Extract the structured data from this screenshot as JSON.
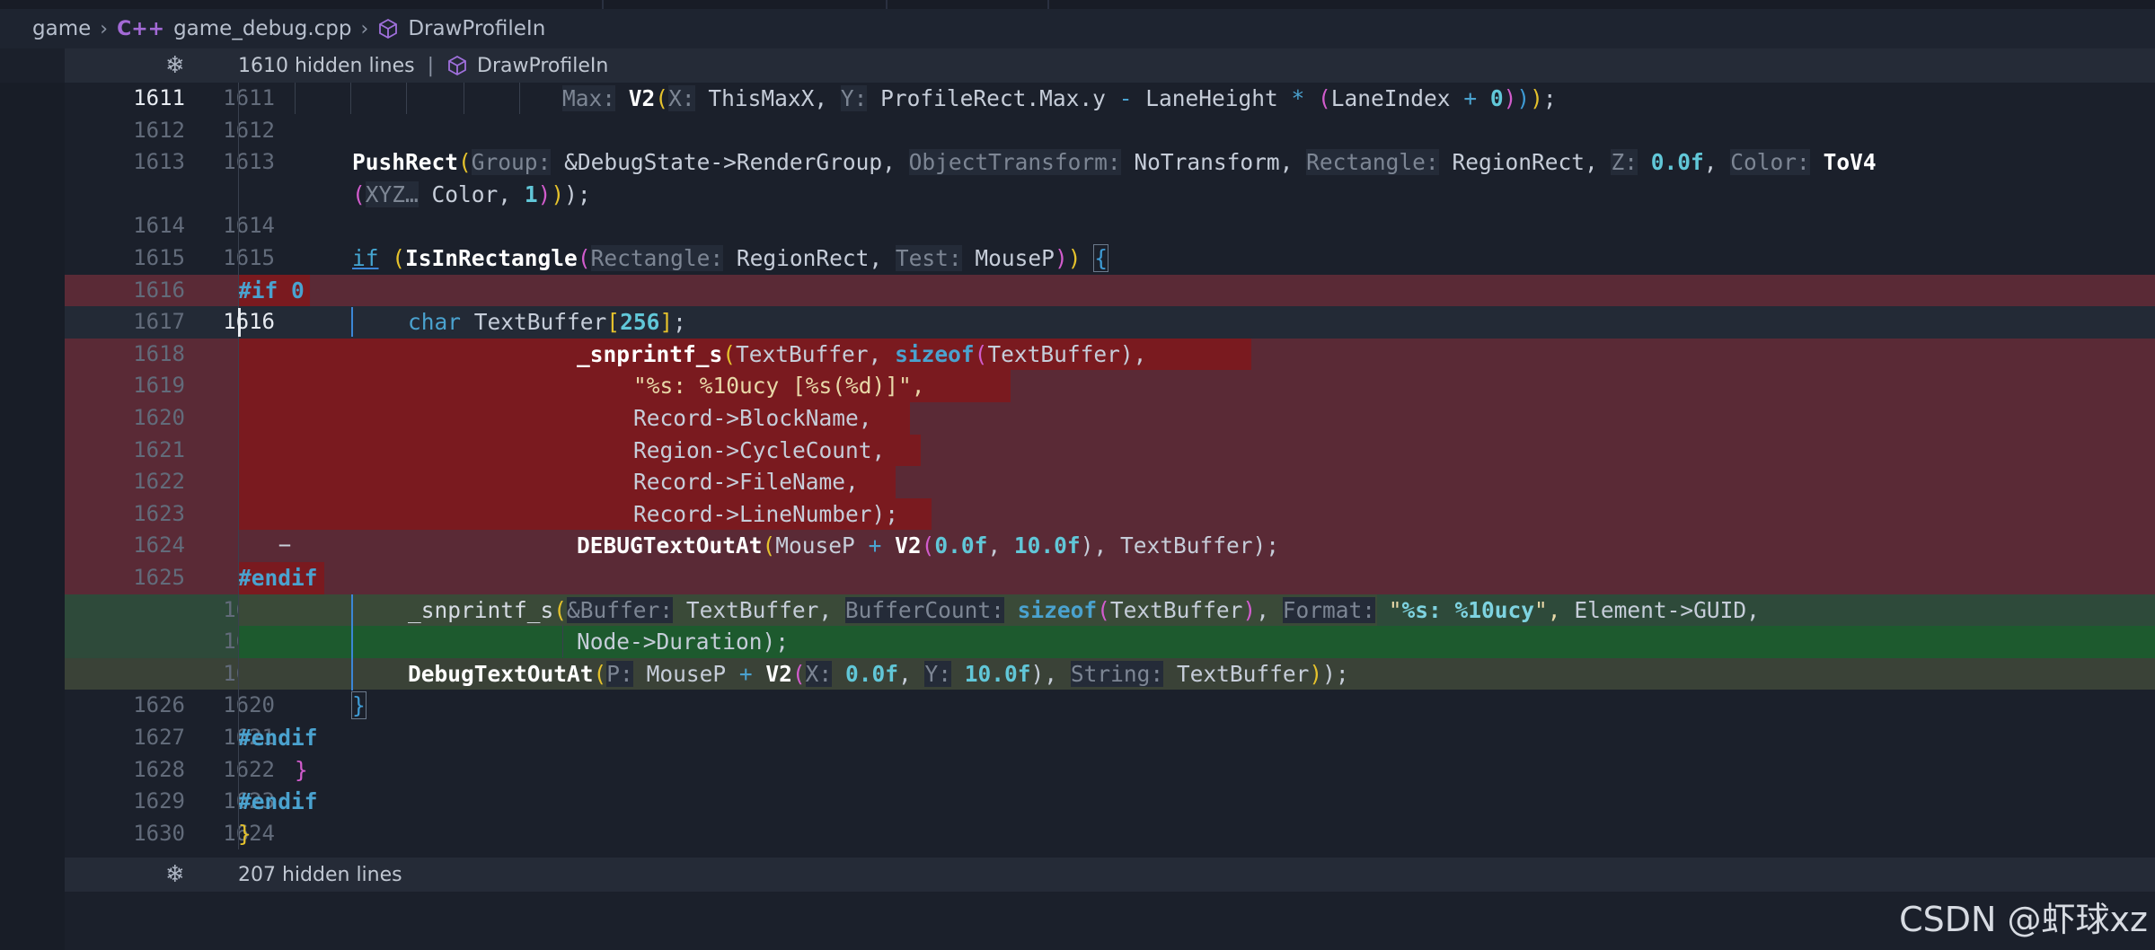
{
  "breadcrumb": {
    "folder": "game",
    "file_icon": "C++",
    "file": "game_debug.cpp",
    "symbol": "DrawProfileIn"
  },
  "top_fold": {
    "hidden": "1610 hidden lines",
    "context": "DrawProfileIn"
  },
  "bottom_fold": {
    "hidden": "207 hidden lines"
  },
  "lines": [
    {
      "old": "1611",
      "new": "1611",
      "mark": ""
    },
    {
      "old": "1612",
      "new": "1612",
      "mark": ""
    },
    {
      "old": "1613",
      "new": "1613",
      "mark": ""
    },
    {
      "old": "",
      "new": "",
      "mark": ""
    },
    {
      "old": "1614",
      "new": "1614",
      "mark": ""
    },
    {
      "old": "1615",
      "new": "1615",
      "mark": ""
    },
    {
      "old": "1616",
      "new": "",
      "mark": "−"
    },
    {
      "old": "1617",
      "new": "1616",
      "mark": ""
    },
    {
      "old": "1618",
      "new": "",
      "mark": "−"
    },
    {
      "old": "1619",
      "new": "",
      "mark": "−"
    },
    {
      "old": "1620",
      "new": "",
      "mark": "−"
    },
    {
      "old": "1621",
      "new": "",
      "mark": "−"
    },
    {
      "old": "1622",
      "new": "",
      "mark": "−"
    },
    {
      "old": "1623",
      "new": "",
      "mark": "−"
    },
    {
      "old": "1624",
      "new": "",
      "mark": "−"
    },
    {
      "old": "1625",
      "new": "",
      "mark": "−"
    },
    {
      "old": "",
      "new": "1617",
      "mark": "+"
    },
    {
      "old": "",
      "new": "1618",
      "mark": "+"
    },
    {
      "old": "",
      "new": "1619",
      "mark": "+"
    },
    {
      "old": "1626",
      "new": "1620",
      "mark": ""
    },
    {
      "old": "1627",
      "new": "1621",
      "mark": ""
    },
    {
      "old": "1628",
      "new": "1622",
      "mark": ""
    },
    {
      "old": "1629",
      "new": "1623",
      "mark": ""
    },
    {
      "old": "1630",
      "new": "1624",
      "mark": ""
    }
  ],
  "code": {
    "l0_hint_max": "Max:",
    "l0_v2": "V2",
    "l0_hint_x": "X:",
    "l0_thismaxx": "ThisMaxX,",
    "l0_hint_y": "Y:",
    "l0_expr": "ProfileRect.Max.y",
    "l0_minus": "-",
    "l0_lane": "LaneHeight",
    "l0_star": "*",
    "l0_laneindex": "LaneIndex",
    "l0_plus": "+",
    "l0_zero": "0",
    "l0_end": ";",
    "l2_pushrect": "PushRect",
    "l2_hint_group": "Group:",
    "l2_debugstate": "&DebugState->RenderGroup,",
    "l2_hint_ot": "ObjectTransform:",
    "l2_notransform": "NoTransform,",
    "l2_hint_rect": "Rectangle:",
    "l2_regionrect": "RegionRect,",
    "l2_hint_z": "Z:",
    "l2_zval": "0.0f",
    "l2_comma": ",",
    "l2_hint_color": "Color:",
    "l2_tov4": "ToV4",
    "l3_hint_xyz": "XYZ…",
    "l3_color": "Color,",
    "l3_one": "1",
    "l3_end": ");",
    "l5_if": "if",
    "l5_isin": "IsInRectangle",
    "l5_hint_rect": "Rectangle:",
    "l5_regionrect": "RegionRect,",
    "l5_hint_test": "Test:",
    "l5_mousep": "MouseP",
    "l5_brace": "{",
    "l6_if0": "#if 0",
    "l7_char": "char",
    "l7_tb": "TextBuffer",
    "l7_256": "256",
    "l7_end": ";",
    "l8_snp": "_snprintf_s",
    "l8_tb": "TextBuffer,",
    "l8_sizeof": "sizeof",
    "l8_tb2": "TextBuffer",
    "l8_end": "),",
    "l9_q1": "\"",
    "l9_fmt": "%s: %10ucy [%s(%d)]",
    "l9_q2": "\",",
    "l10": "Record->BlockName,",
    "l11": "Region->CycleCount,",
    "l12": "Record->FileName,",
    "l13": "Record->LineNumber);",
    "l14_fn": "DEBUGTextOutAt",
    "l14_mouse": "MouseP",
    "l14_plus": "+",
    "l14_v2": "V2",
    "l14_a": "0.0f",
    "l14_comma": ",",
    "l14_b": "10.0f",
    "l14_end": "), TextBuffer);",
    "l15_endif": "#endif",
    "l16_snp": "_snprintf_s",
    "l16_hint_buf": "&Buffer:",
    "l16_tb": "TextBuffer,",
    "l16_hint_bc": "BufferCount:",
    "l16_sizeof": "sizeof",
    "l16_tb2": "TextBuffer",
    "l16_comma": ",",
    "l16_hint_fmt": "Format:",
    "l16_q1": "\"",
    "l16_fmt": "%s: %10ucy",
    "l16_q2": "\",",
    "l16_guid": "Element->GUID,",
    "l17": "Node->Duration);",
    "l18_fn": "DebugTextOutAt",
    "l18_hint_p": "P:",
    "l18_mouse": "MouseP",
    "l18_plus": "+",
    "l18_v2": "V2",
    "l18_hint_x": "X:",
    "l18_a": "0.0f",
    "l18_comma": ",",
    "l18_hint_y": "Y:",
    "l18_b": "10.0f",
    "l18_close": "),",
    "l18_hint_str": "String:",
    "l18_tb": "TextBuffer",
    "l18_end": ");",
    "l19_brace": "}",
    "l20_endif": "#endif",
    "l21_brace": "}",
    "l22_endif": "#endif",
    "l23_brace": "}"
  },
  "watermark": "CSDN @虾球xz"
}
